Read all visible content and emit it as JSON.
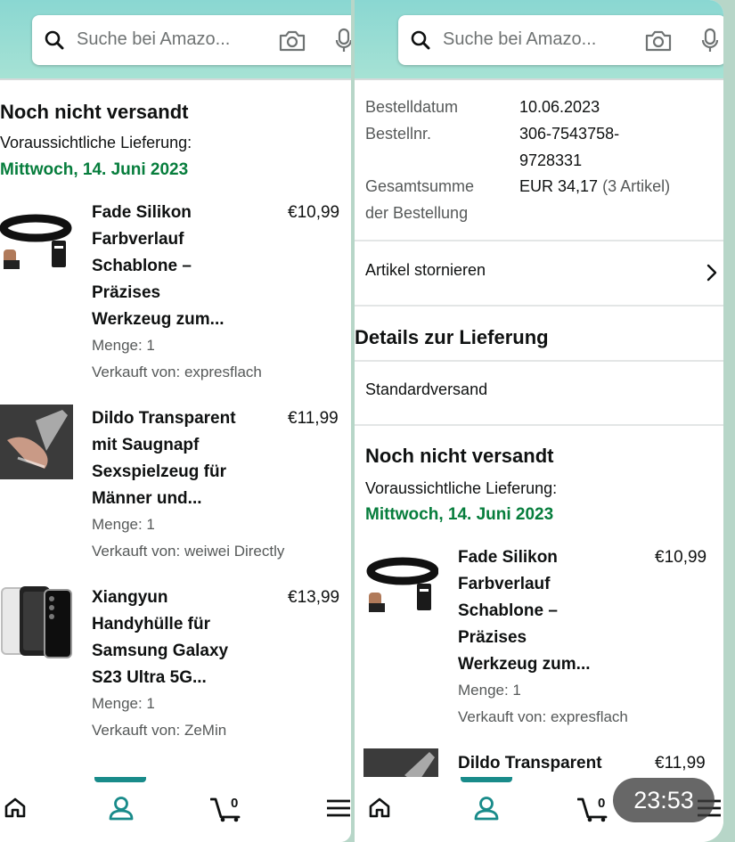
{
  "search": {
    "placeholder": "Suche bei Amazo..."
  },
  "left": {
    "status_title": "Noch nicht versandt",
    "delivery_label": "Voraussichtliche Lieferung:",
    "delivery_date": "Mittwoch, 14. Juni 2023",
    "items": [
      {
        "title_lines": [
          "Fade Silikon",
          "Farbverlauf",
          "Schablone –",
          "Präzises",
          "Werkzeug zum..."
        ],
        "price": "€10,99",
        "quantity": "Menge: 1",
        "seller": "Verkauft von: expresflach"
      },
      {
        "title_lines": [
          "Dildo Transparent",
          "mit Saugnapf",
          "Sexspielzeug für",
          "Männer und..."
        ],
        "price": "€11,99",
        "quantity": "Menge: 1",
        "seller": "Verkauft von: weiwei Directly"
      },
      {
        "title_lines": [
          "Xiangyun",
          "Handyhülle für",
          "Samsung Galaxy",
          "S23 Ultra 5G..."
        ],
        "price": "€13,99",
        "quantity": "Menge: 1",
        "seller": "Verkauft von: ZeMin"
      }
    ]
  },
  "right": {
    "order_date_label": "Bestelldatum",
    "order_date": "10.06.2023",
    "order_number_label": "Bestellnr.",
    "order_number_lines": [
      "306-7543758-",
      "9728331"
    ],
    "total_label_lines": [
      "Gesamtsumme",
      "der Bestellung"
    ],
    "total_value": "EUR 34,17",
    "total_count": "(3 Artikel)",
    "cancel_items": "Artikel stornieren",
    "delivery_details_title": "Details zur Lieferung",
    "shipping_method": "Standardversand",
    "status_title": "Noch nicht versandt",
    "delivery_label": "Voraussichtliche Lieferung:",
    "delivery_date": "Mittwoch, 14. Juni 2023",
    "items": [
      {
        "title_lines": [
          "Fade Silikon",
          "Farbverlauf",
          "Schablone –",
          "Präzises",
          "Werkzeug zum..."
        ],
        "price": "€10,99",
        "quantity": "Menge: 1",
        "seller": "Verkauft von: expresflach"
      },
      {
        "title_lines": [
          "Dildo Transparent"
        ],
        "price": "€11,99"
      }
    ]
  },
  "nav": {
    "cart_count": "0",
    "icons": [
      "home-icon",
      "account-icon",
      "cart-icon",
      "menu-icon"
    ]
  },
  "clock": "23:53",
  "colors": {
    "header_teal": "#8ad7d2",
    "delivery_green": "#067d3c",
    "nav_indicator": "#198b8a"
  }
}
